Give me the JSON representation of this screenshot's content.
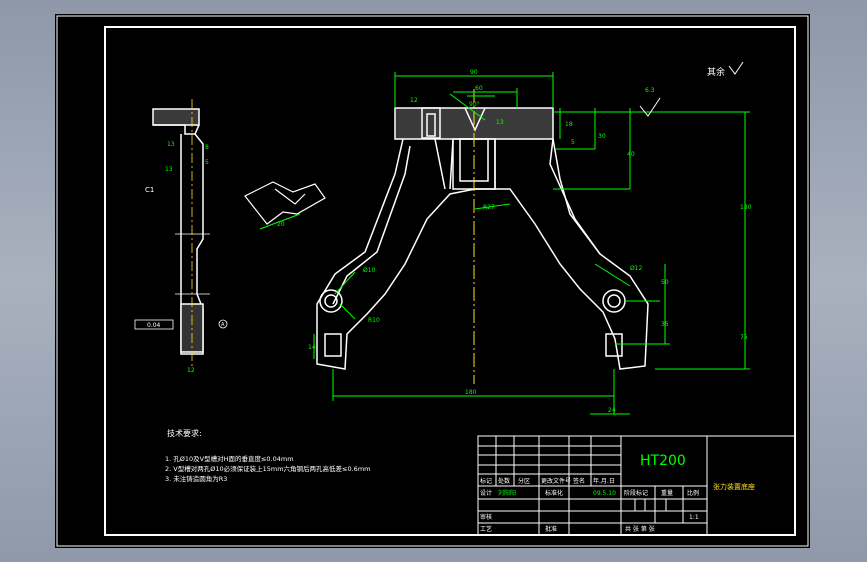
{
  "drawing": {
    "material": "HT200",
    "part_name": "张力装置底座",
    "roughness_other_label": "其余",
    "roughness_value": "6.3",
    "chamfer_note": "C1",
    "tech_requirements": {
      "title": "技术要求:",
      "items": [
        "1. 孔Ø10及V型槽对H面的垂直度≤0.04mm",
        "2. V型槽对两孔Ø10必须保证装上15mm六角钢后两孔高低差≤0.6mm",
        "3. 未注铸造圆角为R3"
      ]
    },
    "dimensions": {
      "top_width": "90",
      "top_offset": "60",
      "v_angle": "90°",
      "depth_left": "12",
      "slot_13": "13",
      "h18": "18",
      "h5": "5",
      "h30": "30",
      "h40": "40",
      "h180": "180",
      "r27": "R27",
      "r10": "R10",
      "r5": "R5",
      "phi10": "Ø10",
      "phi12": "Ø12",
      "h50": "50",
      "h35": "35",
      "h75": "75",
      "base_width": "180",
      "w24": "24",
      "w14": "14",
      "side_13a": "13",
      "side_8": "8",
      "side_13b": "13",
      "side_5": "5",
      "side_12": "12",
      "detail_20": "20",
      "tol_frame": "0.04",
      "datum": "A"
    },
    "title_block": {
      "row1": [
        "标记",
        "处数",
        "分区",
        "更改文件号",
        "签名",
        "年.月.日"
      ],
      "designer_label": "设计",
      "designer_name": "刘阳阳",
      "standard_label": "标准化",
      "date": "09.5.10",
      "stage_label": "阶段标记",
      "weight_label": "重量",
      "scale_label": "比例",
      "scale_value": "1:1",
      "review_label": "审核",
      "process_label": "工艺",
      "approve_label": "批准",
      "sheets_label": "共   张  第   张"
    }
  }
}
